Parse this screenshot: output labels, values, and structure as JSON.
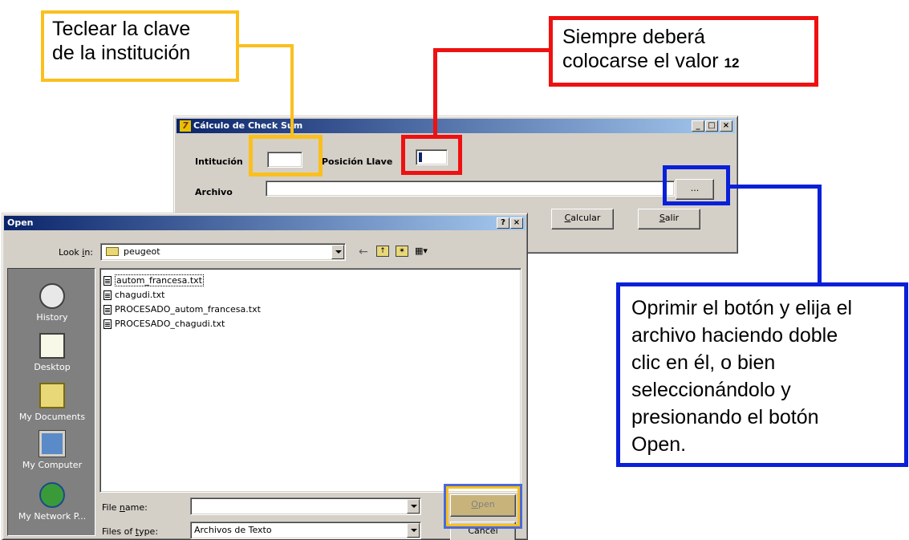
{
  "annotations": {
    "institution_note": [
      "Teclear la clave",
      "de la institución"
    ],
    "position_note_line1": "Siempre deberá",
    "position_note_line2": "colocarse el valor",
    "position_note_value": "12",
    "file_note": [
      "Oprimir el botón y elija el",
      "archivo haciendo doble",
      "clic en él, o bien",
      "seleccionándolo y",
      "presionando el botón",
      "Open."
    ]
  },
  "checksum_window": {
    "title": "Cálculo de Ch",
    "title_tail": "eck Sum",
    "institution_label": "Intitución",
    "position_label": "Posición Llave",
    "file_label": "Archivo",
    "browse_label": "...",
    "calc_label": "Calcular",
    "exit_label": "Salir"
  },
  "open_dialog": {
    "title": "Open",
    "help_btn": "?",
    "close_btn": "×",
    "look_in_label": "Look in:",
    "look_in_value": "peugeot",
    "places": [
      "History",
      "Desktop",
      "My Documents",
      "My Computer",
      "My Network P..."
    ],
    "files": [
      "autom_francesa.txt",
      "chagudi.txt",
      "PROCESADO_autom_francesa.txt",
      "PROCESADO_chagudi.txt"
    ],
    "file_name_label": "File name:",
    "file_name_value": "",
    "files_of_type_label": "Files of type:",
    "files_of_type_value": "Archivos de Texto",
    "open_btn": "Open",
    "cancel_btn": "Cancel"
  },
  "colors": {
    "yellow_callout": "#fbbf1e",
    "red_callout": "#ee1111",
    "blue_callout": "#0a1fd8",
    "titlebar_start": "#0a246a",
    "places_bg": "#808080"
  }
}
